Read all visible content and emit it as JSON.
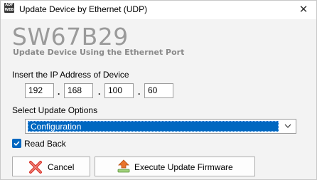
{
  "window": {
    "title": "Update Device by Ethernet (UDP)",
    "app_icon_text_1": "ADF",
    "app_icon_text_2": "WEB",
    "close_glyph": "✕"
  },
  "header": {
    "product": "SW67B29",
    "subtitle": "Update Device Using the Ethernet Port"
  },
  "ip": {
    "label": "Insert the IP Address of Device",
    "octets": [
      "192",
      "168",
      "100",
      "60"
    ],
    "separator": "."
  },
  "options": {
    "label": "Select Update Options",
    "selected": "Configuration"
  },
  "read_back": {
    "label": "Read Back",
    "checked": true
  },
  "buttons": {
    "cancel": "Cancel",
    "execute": "Execute Update Firmware"
  },
  "colors": {
    "accent": "#0067c0",
    "product_gray": "#9a9a9a",
    "cancel_red": "#d9342b"
  }
}
